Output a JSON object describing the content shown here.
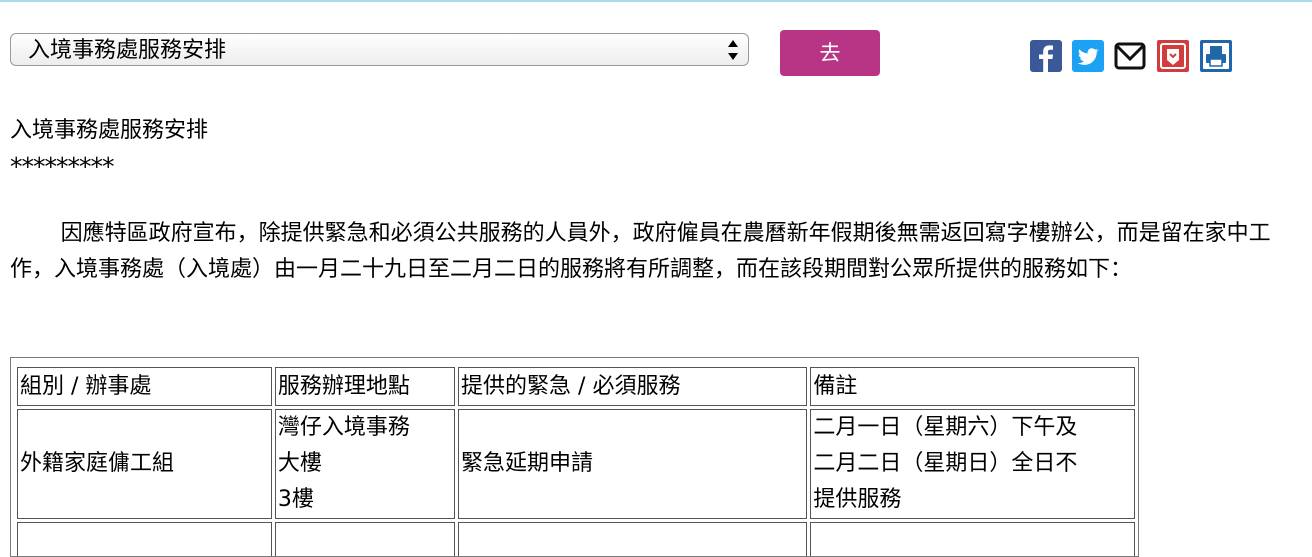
{
  "page": {
    "dropdown_selected": "入境事務處服務安排",
    "go_button_label": "去",
    "share_icons": [
      "facebook-icon",
      "twitter-icon",
      "email-icon",
      "save-icon",
      "print-icon"
    ],
    "colors": {
      "go_button": "#b83586",
      "facebook": "#3b5998",
      "twitter": "#1da1f2",
      "save": "#d33c3c",
      "print": "#2266aa"
    }
  },
  "article": {
    "title": "入境事務處服務安排",
    "divider": "*********",
    "intro": "因應特區政府宣布，除提供緊急和必須公共服務的人員外，政府僱員在農曆新年假期後無需返回寫字樓辦公，而是留在家中工作，入境事務處（入境處）由一月二十九日至二月二日的服務將有所調整，而在該段期間對公眾所提供的服務如下："
  },
  "table": {
    "headers": [
      "組別 / 辦事處",
      "服務辦理地點",
      "提供的緊急 / 必須服務",
      "備註"
    ],
    "rows": [
      {
        "unit": "外籍家庭傭工組",
        "location_lines": [
          "灣仔入境事務",
          "大樓",
          "3樓"
        ],
        "service": "緊急延期申請",
        "remark_lines": [
          "二月一日（星期六）下午及",
          "二月二日（星期日）全日不",
          "提供服務"
        ]
      }
    ]
  }
}
